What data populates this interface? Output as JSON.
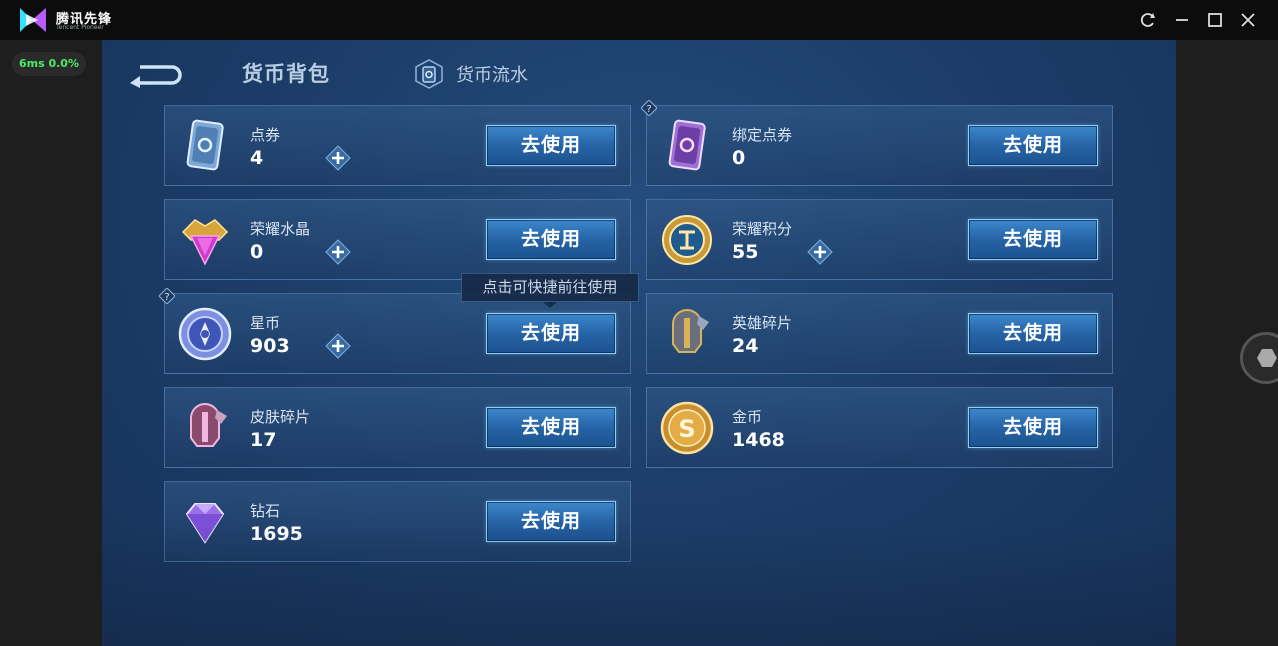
{
  "app": {
    "name": "腾讯先锋",
    "subtitle": "Tencent Pioneer",
    "ping": "6ms  0.0%"
  },
  "header": {
    "title": "货币背包",
    "flow_label": "货币流水"
  },
  "tooltip": "点击可快捷前往使用",
  "use_label": "去使用",
  "currencies": [
    {
      "name": "点券",
      "value": "4",
      "icon": "coupon-card-icon",
      "plus": true
    },
    {
      "name": "绑定点券",
      "value": "0",
      "icon": "bound-coupon-card-icon",
      "plus": false,
      "help": true
    },
    {
      "name": "荣耀水晶",
      "value": "0",
      "icon": "glory-crystal-icon",
      "plus": true
    },
    {
      "name": "荣耀积分",
      "value": "55",
      "icon": "glory-points-icon",
      "plus": true
    },
    {
      "name": "星币",
      "value": "903",
      "icon": "star-coin-icon",
      "plus": true,
      "help": true
    },
    {
      "name": "英雄碎片",
      "value": "24",
      "icon": "hero-fragment-icon",
      "plus": false
    },
    {
      "name": "皮肤碎片",
      "value": "17",
      "icon": "skin-fragment-icon",
      "plus": false
    },
    {
      "name": "金币",
      "value": "1468",
      "icon": "gold-coin-icon",
      "plus": false
    },
    {
      "name": "钻石",
      "value": "1695",
      "icon": "diamond-icon",
      "plus": false
    }
  ]
}
